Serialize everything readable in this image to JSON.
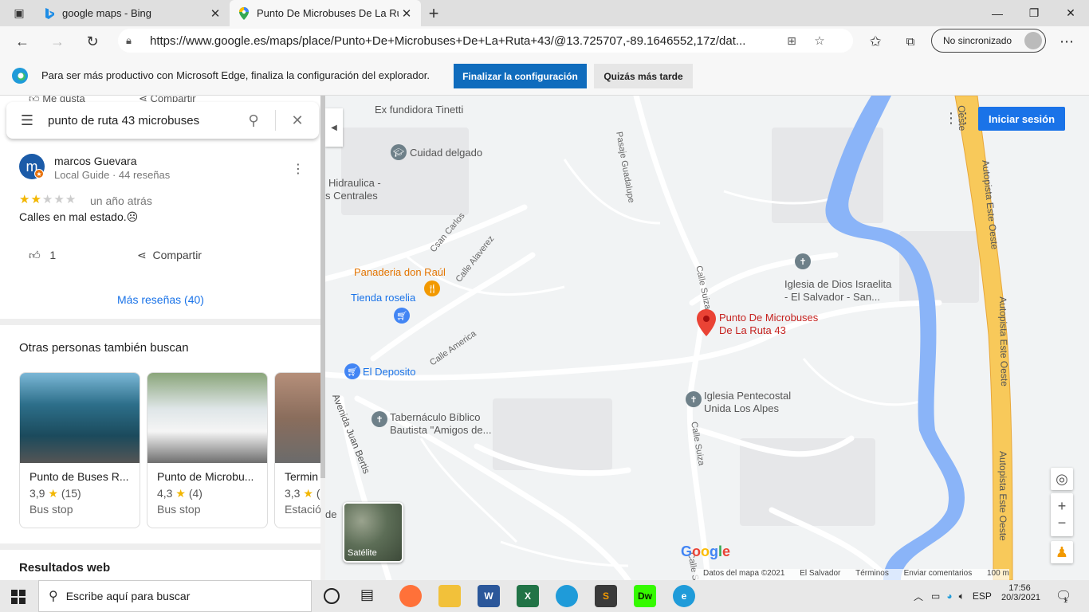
{
  "browser": {
    "tabs": [
      {
        "title": "google maps - Bing",
        "favicon": "bing-icon"
      },
      {
        "title": "Punto De Microbuses De La Ruta",
        "favicon": "google-maps-icon"
      }
    ],
    "new_tab": "+",
    "url": "https://www.google.es/maps/place/Punto+De+Microbuses+De+La+Ruta+43/@13.725707,-89.1646552,17z/dat...",
    "sync_label": "No sincronizado",
    "infobar": {
      "message": "Para ser más productivo con Microsoft Edge, finaliza la configuración del explorador.",
      "primary_button": "Finalizar la configuración",
      "secondary_button": "Quizás más tarde"
    }
  },
  "panel": {
    "top_actions": {
      "like": "Me gusta",
      "share": "Compartir"
    },
    "search_query": "punto de ruta 43 microbuses",
    "review": {
      "author": "marcos Guevara",
      "author_initial": "m",
      "meta": "Local Guide · 44 reseñas",
      "stars": 2,
      "time": "un año atrás",
      "text": "Calles en mal estado.☹",
      "like_count": "1",
      "share_label": "Compartir"
    },
    "more_reviews": "Más reseñas (40)",
    "others_title": "Otras personas también buscan",
    "cards": [
      {
        "title": "Punto de Buses R...",
        "rating": "3,9",
        "count": "(15)",
        "kind": "Bus stop"
      },
      {
        "title": "Punto de Microbu...",
        "rating": "4,3",
        "count": "(4)",
        "kind": "Bus stop"
      },
      {
        "title": "Termin",
        "rating": "3,3",
        "count": "(",
        "kind": "Estació"
      }
    ],
    "web_results": "Resultados web"
  },
  "map": {
    "signin": "Iniciar sesión",
    "labels": {
      "fundidora": "Ex fundidora Tinetti",
      "cuidad": "Cuidad delgado",
      "hidraulica": "Hidraulica -",
      "centrales": "s Centrales",
      "panaderia": "Panaderia don Raúl",
      "tienda": "Tienda roselia",
      "deposito": "El Deposito",
      "tabernaculo1": "Tabernáculo Bíblico",
      "tabernaculo2": "Bautista \"Amigos de...",
      "iglesia_dios1": "Iglesia de Dios Israelita",
      "iglesia_dios2": "- El Salvador -  San...",
      "punto1": "Punto De Microbuses",
      "punto2": "De La Ruta 43",
      "pentecostal1": "Iglesia Pentecostal",
      "pentecostal2": "Unida Los Alpes",
      "de": "de",
      "pasaje_guadalupe": "Pasaje Guadalupe",
      "csan_carlos": "Csan Carlos",
      "calle_alvarez": "Calle Alaverez",
      "calle_america": "Calle America",
      "calle_suiza1": "Calle Suiza",
      "calle_suiza2": "Calle Suiza",
      "calle_suiza3": "Calle Suiza",
      "avenida_bertis": "Avenida Juan Bertis",
      "autopista1": "Autopista Este Oeste",
      "autopista2": "Autopista Este Oeste",
      "autopista3": "Autopista Este Oeste",
      "oeste": "Oeste"
    },
    "satellite_label": "Satélite",
    "google_logo": "Google",
    "footer": {
      "data": "Datos del mapa ©2021",
      "country": "El Salvador",
      "terms": "Términos",
      "feedback": "Enviar comentarios",
      "scale": "100 m"
    }
  },
  "taskbar": {
    "search_placeholder": "Escribe aquí para buscar",
    "lang": "ESP",
    "time": "17:56",
    "date": "20/3/2021",
    "notif_count": "1"
  },
  "colors": {
    "accent": "#1a73e8",
    "edge_button": "#0f6cbd",
    "star": "#f2b600",
    "pin_red": "#ea4335",
    "water": "#8ab4f8",
    "highway": "#f8c95a"
  }
}
